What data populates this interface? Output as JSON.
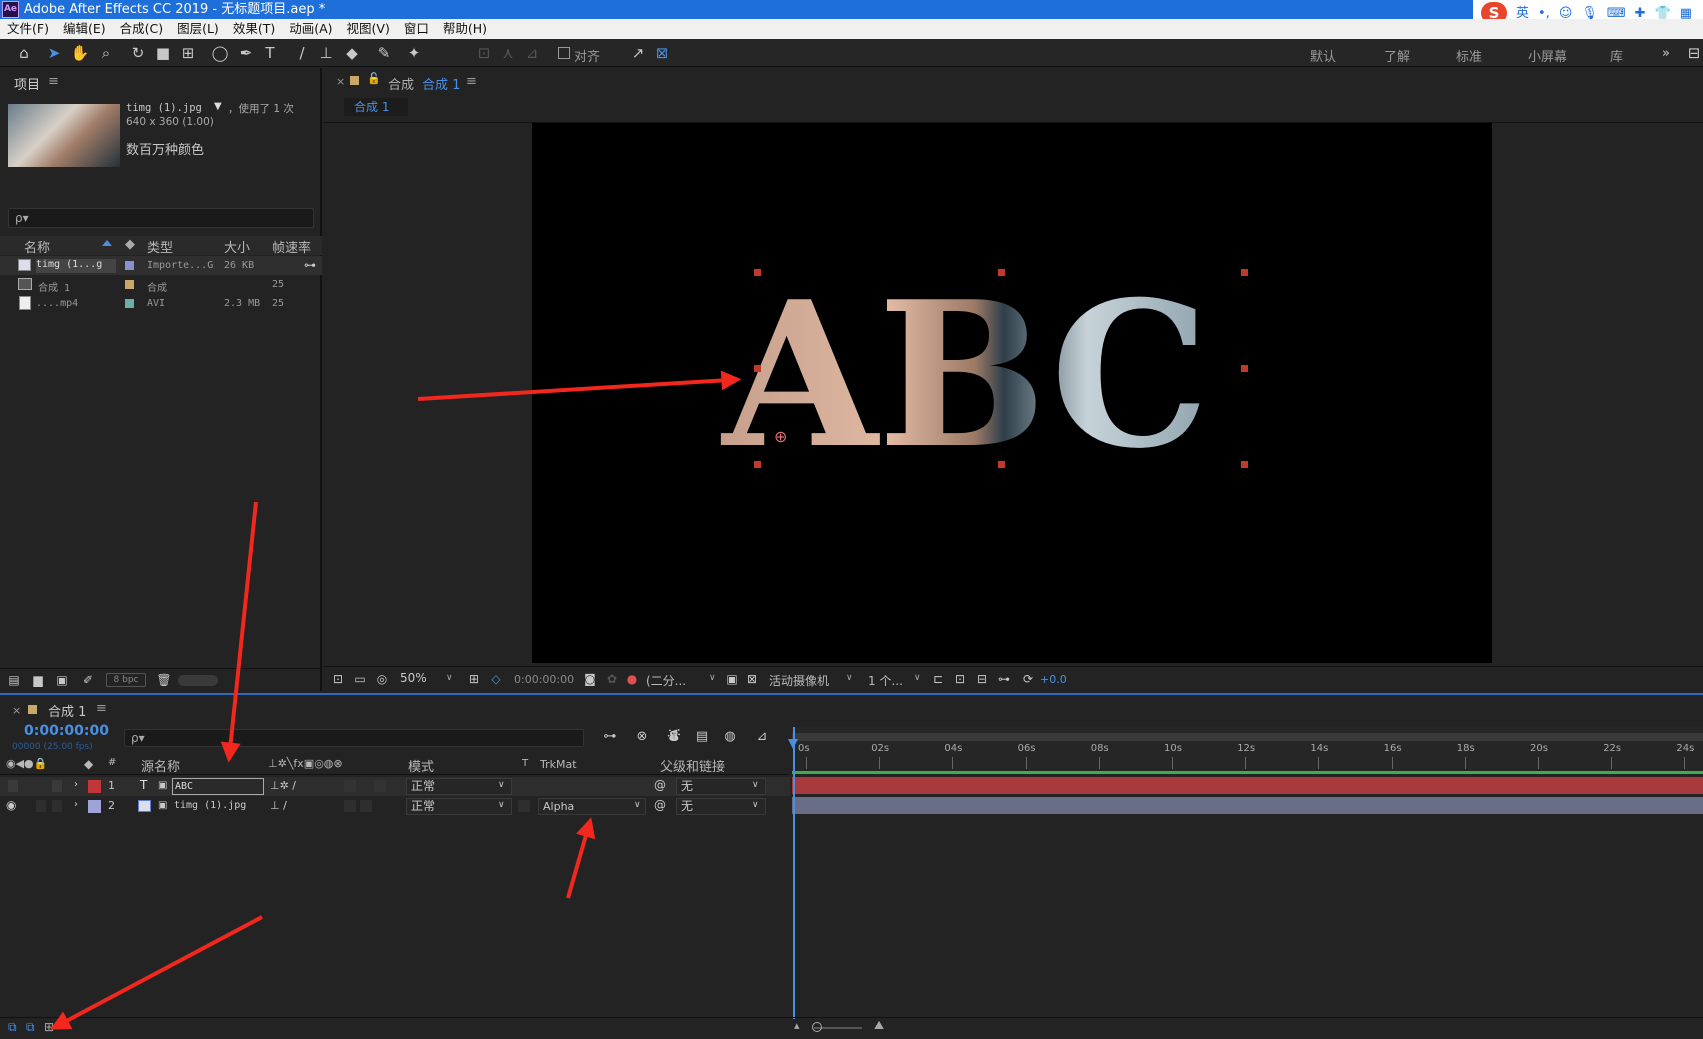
{
  "app": {
    "icon_text": "Ae",
    "title": "Adobe After Effects CC 2019 - 无标题项目.aep *"
  },
  "ime": {
    "logo": "S",
    "mode": "英"
  },
  "menu": [
    "文件(F)",
    "编辑(E)",
    "合成(C)",
    "图层(L)",
    "效果(T)",
    "动画(A)",
    "视图(V)",
    "窗口",
    "帮助(H)"
  ],
  "toolbar": {
    "align_label": "对齐",
    "workspaces": [
      "默认",
      "了解",
      "标准",
      "小屏幕",
      "库"
    ],
    "more": "»"
  },
  "project": {
    "title": "项目",
    "menu_icon": "≡",
    "item_name": "timg (1).jpg",
    "item_usage": "，使用了 1 次",
    "item_dims": "640 x 360 (1.00)",
    "item_colors": "数百万种颜色",
    "search_placeholder": "ρ▾",
    "columns": [
      "名称",
      "类型",
      "大小",
      "帧速率"
    ],
    "rows": [
      {
        "name": "timg (1...g",
        "type": "Importe...G",
        "size": "26 KB",
        "fps": "",
        "color": "#8a8fd0"
      },
      {
        "name": "合成 1",
        "type": "合成",
        "size": "",
        "fps": "25",
        "color": "#c8a96a"
      },
      {
        "name": "....mp4",
        "type": "AVI",
        "size": "2.3 MB",
        "fps": "25",
        "color": "#6ab0a8"
      }
    ],
    "bpc": "8 bpc"
  },
  "comp": {
    "tab_label": "合成",
    "tab_name": "合成 1",
    "menu_icon": "≡",
    "breadcrumb": "合成 1",
    "viewer_text": "ABC",
    "zoom": "50%",
    "timecode": "0:00:00:00",
    "resolution": "(二分...",
    "camera": "活动摄像机",
    "views": "1 个...",
    "exposure": "+0.0"
  },
  "timeline": {
    "comp_name": "合成 1",
    "timecode": "0:00:00:00",
    "frame_info": "00000 (25.00 fps)",
    "search_placeholder": "ρ▾",
    "col_source": "源名称",
    "col_mode": "模式",
    "col_t": "T",
    "col_trkmat": "TrkMat",
    "col_parent": "父级和链接",
    "hash": "#",
    "ticks": [
      "0s",
      "02s",
      "04s",
      "06s",
      "08s",
      "10s",
      "12s",
      "14s",
      "16s",
      "18s",
      "20s",
      "22s",
      "24s"
    ],
    "layers": [
      {
        "num": "1",
        "type": "T",
        "name": "ABC",
        "mode": "正常",
        "trkmat": "",
        "parent": "无",
        "color": "#c0363a"
      },
      {
        "num": "2",
        "type": "img",
        "name": "timg (1).jpg",
        "mode": "正常",
        "trkmat": "Alpha",
        "parent": "无",
        "color": "#9ea4d8"
      }
    ]
  },
  "colors": {
    "accent": "#1e6fd9",
    "arrow": "#f2271e",
    "bar1": "#a8393c",
    "bar2": "#6a6d86"
  }
}
